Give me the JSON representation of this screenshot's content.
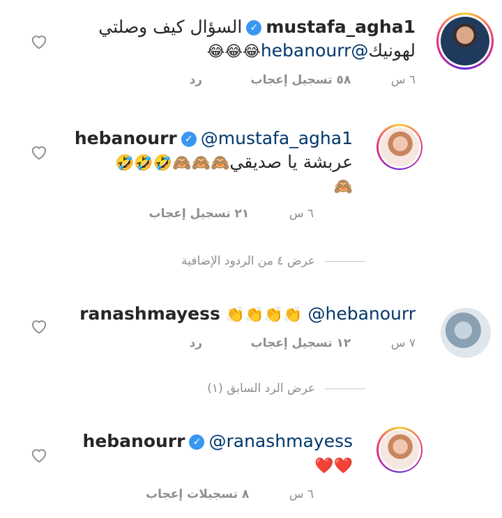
{
  "comments": [
    {
      "username": "mustafa_agha1",
      "verified": true,
      "text_line1": "السؤال كيف وصلتي",
      "mention": "@hebanourr",
      "text_line2_tail": "لهونيك",
      "emojis": "😂😂😂",
      "time": "٦ س",
      "likes": "٥٨ تسجيل إعجاب",
      "reply": "رد"
    },
    {
      "username": "hebanourr",
      "verified": true,
      "mention": "@mustafa_agha1",
      "text_line1": "عربشة يا صديقي",
      "emojis_line1": "🙈🙈🙈🤣🤣🤣",
      "emojis_line2": "🙈",
      "time": "٦ س",
      "likes": "٢١ تسجيل إعجاب"
    },
    {
      "username": "ranashmayess",
      "verified": false,
      "emojis": "👏👏👏👏",
      "mention": "@hebanourr",
      "time": "٧ س",
      "likes": "١٢ تسجيل إعجاب",
      "reply": "رد"
    },
    {
      "username": "hebanourr",
      "verified": true,
      "mention": "@ranashmayess",
      "emojis": "❤️❤️",
      "time": "٦ س",
      "likes": "٨ تسجيلات إعجاب"
    }
  ],
  "view_more_replies": "عرض ٤ من الردود الإضافية",
  "view_previous_reply": "عرض الرد السابق (١)",
  "icons": {
    "like": "heart-outline-icon",
    "verified": "verified-badge-icon"
  },
  "colors": {
    "verified": "#3897f0",
    "mention": "#00376b",
    "meta": "#8e8e8e"
  }
}
